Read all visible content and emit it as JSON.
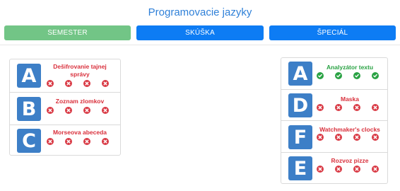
{
  "title": "Programovacie jazyky",
  "tabs": [
    {
      "label": "Semester",
      "active": true
    },
    {
      "label": "Skúška",
      "active": false
    },
    {
      "label": "Špeciál",
      "active": false
    }
  ],
  "colors": {
    "title": "#2f80d8",
    "tab_active": "#72c586",
    "tab": "#0d7cf4",
    "letter_bg": "#3d7fc7",
    "fail": "#d9303c",
    "ok": "#2aa244"
  },
  "left_panel": {
    "items": [
      {
        "letter": "A",
        "title": "Dešifrovanie tajnej správy",
        "results": [
          "fail",
          "fail",
          "fail",
          "fail"
        ]
      },
      {
        "letter": "B",
        "title": "Zoznam zlomkov",
        "results": [
          "fail",
          "fail",
          "fail",
          "fail"
        ]
      },
      {
        "letter": "C",
        "title": "Morseova abeceda",
        "results": [
          "fail",
          "fail",
          "fail",
          "fail"
        ]
      }
    ]
  },
  "right_panel": {
    "items": [
      {
        "letter": "A",
        "title": "Analyzátor textu",
        "results": [
          "ok",
          "ok",
          "ok",
          "ok"
        ]
      },
      {
        "letter": "D",
        "title": "Maska",
        "results": [
          "fail",
          "fail",
          "fail",
          "fail"
        ]
      },
      {
        "letter": "F",
        "title": "Watchmaker's clocks",
        "results": [
          "fail",
          "fail",
          "fail",
          "fail"
        ]
      },
      {
        "letter": "E",
        "title": "Rozvoz pizze",
        "results": [
          "fail",
          "fail",
          "fail",
          "fail"
        ]
      }
    ]
  }
}
